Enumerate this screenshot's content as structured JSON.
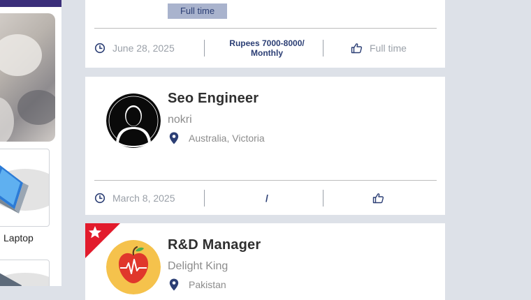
{
  "sidebar": {
    "laptop_label": "Laptop"
  },
  "jobs": [
    {
      "job_type_badge": "Full time",
      "date": "June 28, 2025",
      "salary_line1": "Rupees 7000-8000/",
      "salary_line2": "Monthly",
      "job_type": "Full time",
      "icons": {
        "date": "clock-icon",
        "type": "thumbs-up-icon"
      }
    },
    {
      "title": "Seo Engineer",
      "company": "nokri",
      "location": "Australia, Victoria",
      "date": "March 8, 2025",
      "salary": "/",
      "job_type": "",
      "logo": "avatar-silhouette-icon",
      "icons": {
        "location": "map-pin-icon",
        "date": "clock-icon",
        "type": "thumbs-up-icon"
      }
    },
    {
      "title": "R&D Manager",
      "company": "Delight King",
      "location": "Pakistan",
      "featured": true,
      "logo": "apple-heartbeat-icon",
      "icons": {
        "featured": "star-icon",
        "location": "map-pin-icon"
      }
    }
  ],
  "colors": {
    "accent": "#2b3e74",
    "badge_bg": "#a9b3cd",
    "ribbon": "#e21b2c",
    "page_bg": "#dde1e8"
  }
}
